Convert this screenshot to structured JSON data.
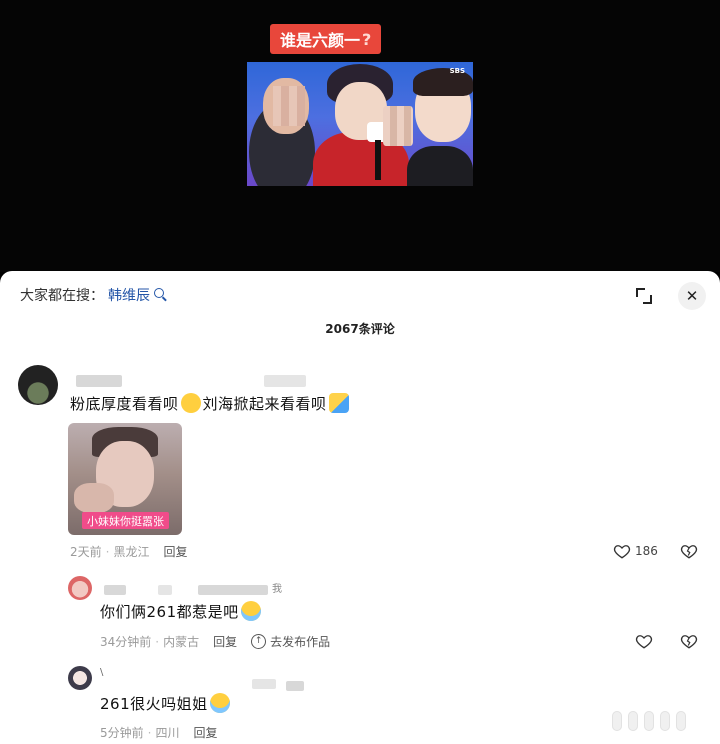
{
  "video": {
    "caption": "谁是六颜一",
    "caption_mark": "?",
    "channel_logo": "SBS"
  },
  "sheet": {
    "search_prefix": "大家都在搜：",
    "search_query": "韩维辰",
    "comment_count": "2067条评论",
    "icons": {
      "expand": "expand-icon",
      "close": "close-icon",
      "like": "heart-outline-icon",
      "dislike": "broken-heart-icon"
    }
  },
  "comments": [
    {
      "text_part1": "粉底厚度看看呗",
      "text_part2": "刘海掀起来看看呗",
      "emoji1": "kiss-face-emoji",
      "emoji2": "hug-face-emoji",
      "sticker_caption": "小妹妹你挺嚣张",
      "time": "2天前",
      "location": "黑龙江",
      "reply_label": "回复",
      "like_count": "186"
    },
    {
      "text": "你们俩261都惹是吧",
      "emoji": "laughing-crying-emoji",
      "time": "34分钟前",
      "location": "内蒙古",
      "reply_label": "回复",
      "publish_label": "去发布作品",
      "username_tail": "我"
    },
    {
      "text": "261很火吗姐姐",
      "emoji": "laughing-crying-emoji",
      "time": "5分钟前",
      "location": "四川",
      "reply_label": "回复"
    }
  ]
}
